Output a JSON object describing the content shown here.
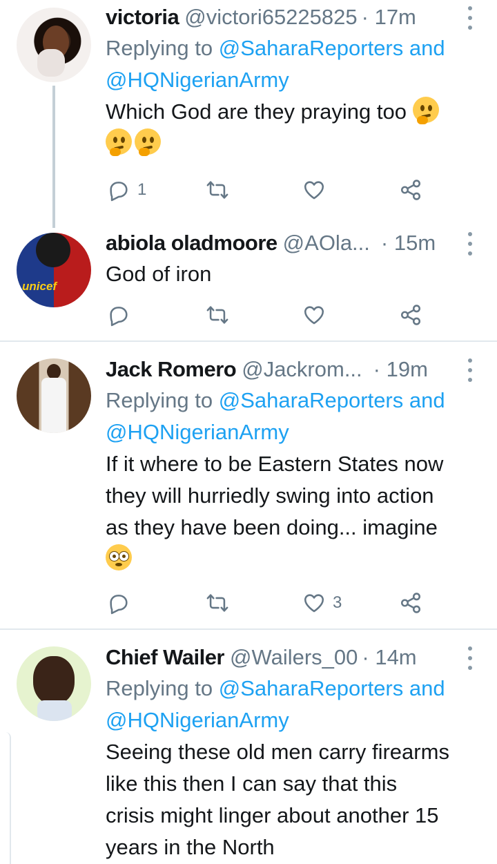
{
  "tweets": [
    {
      "name": "victoria",
      "handle": "@victori65225825",
      "time": "· 17m",
      "replying_prefix": "Replying to",
      "replying_mention1": "@SaharaReporters",
      "replying_and": "and",
      "replying_mention2": "@HQNigerianArmy",
      "text": "Which God are they praying too",
      "emoji_icons": [
        "thinking-face-emoji",
        "thinking-face-emoji",
        "thinking-face-emoji"
      ],
      "reply_count": "1",
      "retweet_count": "",
      "like_count": ""
    },
    {
      "name": "abiola oladmoore",
      "handle": "@AOla...",
      "time": "· 15m",
      "text": "God of iron",
      "reply_count": "",
      "retweet_count": "",
      "like_count": ""
    },
    {
      "name": "Jack Romero",
      "handle": "@Jackrom...",
      "time": "· 19m",
      "replying_prefix": "Replying to",
      "replying_mention1": "@SaharaReporters",
      "replying_and": "and",
      "replying_mention2": "@HQNigerianArmy",
      "text_lines": [
        "If it where to be Eastern States now",
        "they will hurriedly swing into action",
        "as they have been doing... imagine"
      ],
      "emoji_icons": [
        "flushed-face-emoji"
      ],
      "reply_count": "",
      "retweet_count": "",
      "like_count": "3"
    },
    {
      "name": "Chief Wailer",
      "handle": "@Wailers_00",
      "time": "· 14m",
      "replying_prefix": "Replying to",
      "replying_mention1": "@SaharaReporters",
      "replying_and": "and",
      "replying_mention2": "@HQNigerianArmy",
      "text_lines": [
        "Seeing these old men carry firearms",
        "like this then I can say that this",
        "crisis might linger about another 15",
        "years in the North"
      ]
    }
  ],
  "colors": {
    "link": "#1da1f2",
    "secondary": "#657786",
    "divider": "#e1e8ed",
    "thread_line": "#c4cfd6"
  }
}
